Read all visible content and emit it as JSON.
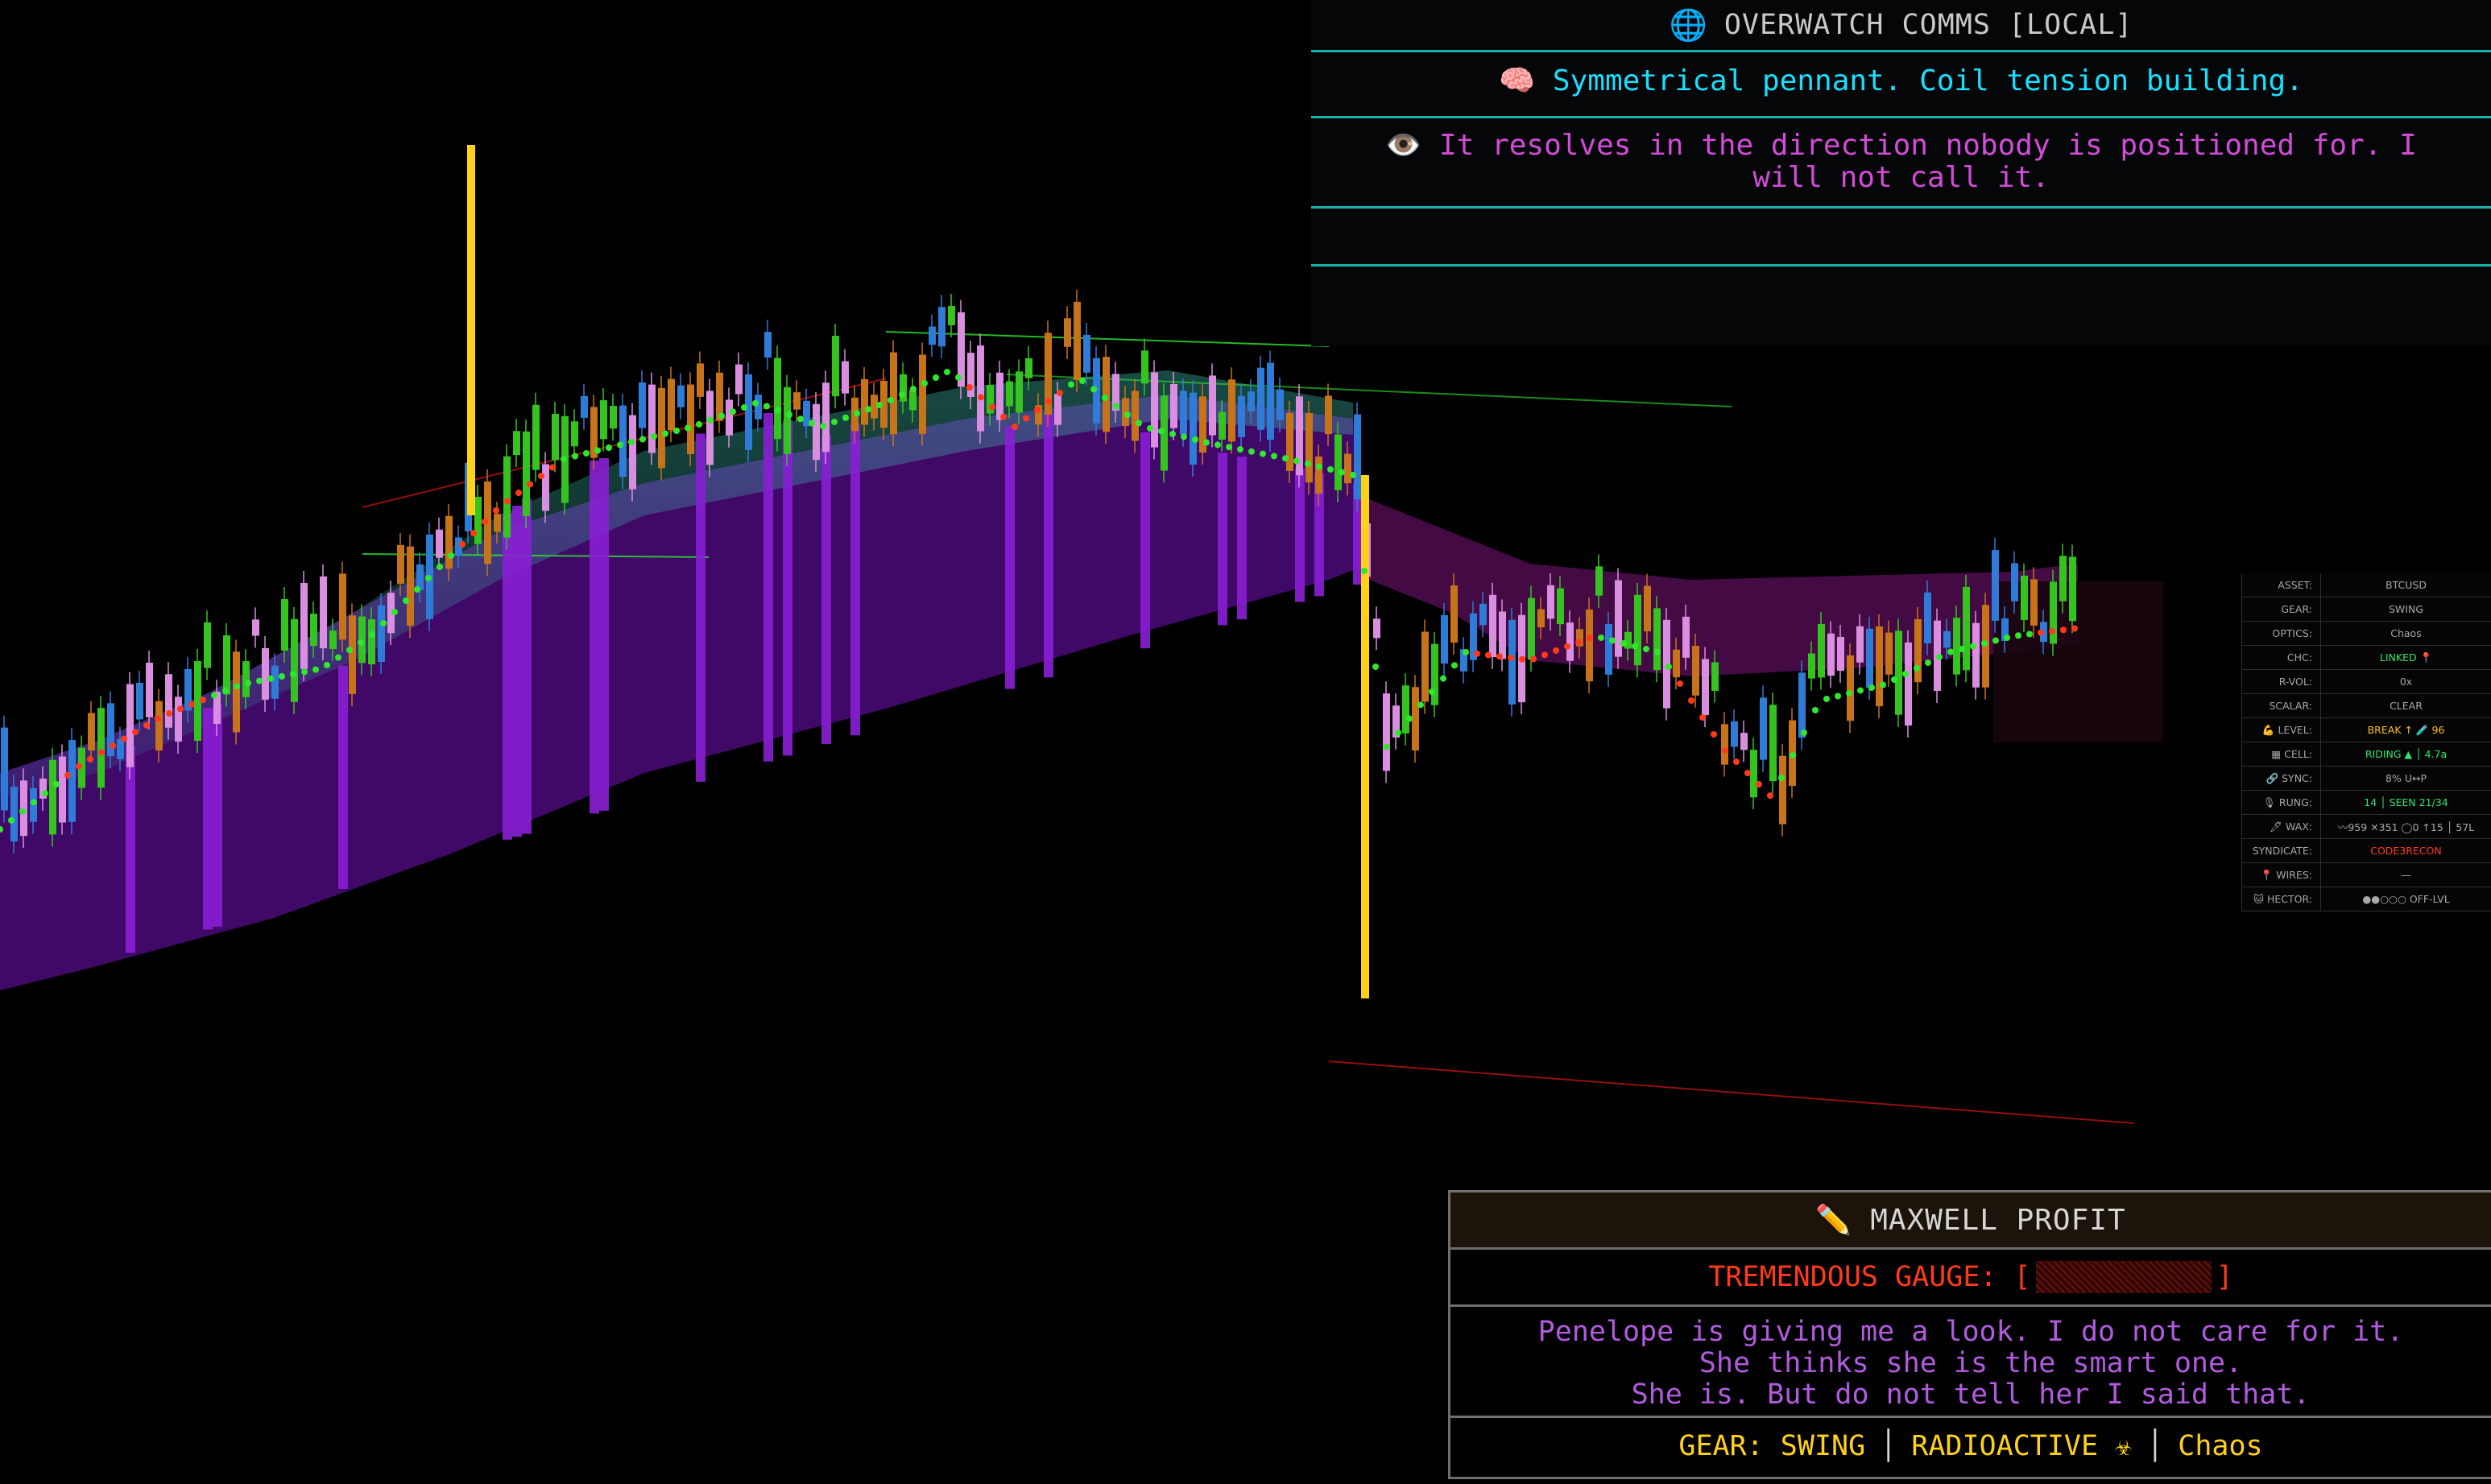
{
  "comms": {
    "globe_icon": "🌐",
    "title": "OVERWATCH COMMS [LOCAL]",
    "messages": [
      {
        "icon": "🧠",
        "text": "Symmetrical pennant. Coil tension building.",
        "color": "#18e0ff"
      },
      {
        "icon": "👁️",
        "text": "It resolves in the direction nobody is positioned for. I will not call it.",
        "color": "#d24cd7"
      }
    ]
  },
  "stats": [
    {
      "icon": "",
      "key": "ASSET:",
      "value": "BTCUSD",
      "color": "#a8a8a8"
    },
    {
      "icon": "",
      "key": "GEAR:",
      "value": "SWING",
      "color": "#a8a8a8"
    },
    {
      "icon": "",
      "key": "OPTICS:",
      "value": "Chaos",
      "color": "#a8a8a8"
    },
    {
      "icon": "",
      "key": "CHC:",
      "value": "LINKED 📍",
      "color": "#2ee86a"
    },
    {
      "icon": "",
      "key": "R-VOL:",
      "value": "0x",
      "color": "#a8a8a8"
    },
    {
      "icon": "",
      "key": "SCALAR:",
      "value": "CLEAR",
      "color": "#a8a8a8"
    },
    {
      "icon": "💪",
      "key": "LEVEL:",
      "value": "BREAK ↑ 🧪 96",
      "color": "#ffc21a"
    },
    {
      "icon": "▦",
      "key": "CELL:",
      "value": "RIDING ▲ │ 4.7a",
      "color": "#2ee86a"
    },
    {
      "icon": "🔗",
      "key": "SYNC:",
      "value": "8% U↔P",
      "color": "#a8a8a8"
    },
    {
      "icon": "🎙",
      "key": "RUNG:",
      "value": "14 │ SEEN 21/34",
      "color": "#2ee86a"
    },
    {
      "icon": "🖊",
      "key": "WAX:",
      "value": "〰959 ✕351 ◯0 ↑15 │ 57L",
      "color": "#a8a8a8"
    },
    {
      "icon": "",
      "key": "SYNDICATE:",
      "value": "CODE3RECON",
      "color": "#ff3a1a"
    },
    {
      "icon": "📍",
      "key": "WIRES:",
      "value": "—",
      "color": "#a8a8a8"
    },
    {
      "icon": "🐱",
      "key": "HECTOR:",
      "value": "●●○○○ OFF-LVL",
      "color": "#a8a8a8"
    }
  ],
  "maxwell": {
    "pencil_icon": "✏️",
    "title": "MAXWELL PROFIT",
    "gauge_label": "TREMENDOUS GAUGE: [",
    "gauge_close": "]",
    "gauge_level": 0,
    "quote_lines": [
      "Penelope is giving me a look. I do not care for it.",
      "She thinks she is the smart one.",
      "She is. But do not tell her I said that."
    ],
    "gear_text": "GEAR: SWING",
    "radioactive_text": "RADIOACTIVE ☣",
    "optics_text": "Chaos",
    "separator": "│"
  },
  "colors": {
    "up_green": "#35c41f",
    "up_blue": "#2f7bd8",
    "down_pink": "#d98ee0",
    "down_orange": "#c7731a",
    "spike_yellow": "#ffd21a",
    "volume_purple": "#8a1fd6",
    "trail_green": "#2ee82e",
    "trail_red": "#ff3a1a"
  }
}
